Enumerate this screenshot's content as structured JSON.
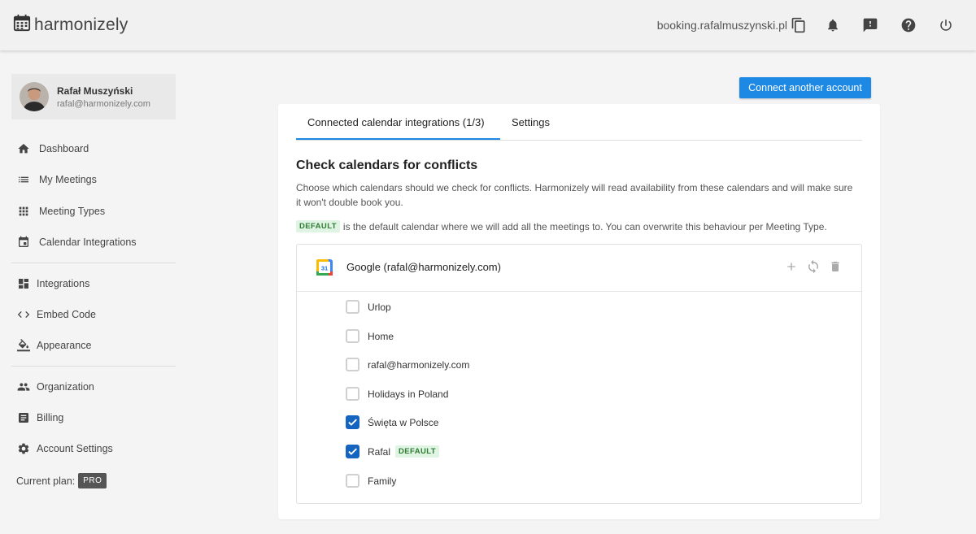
{
  "header": {
    "brand": "harmonizely",
    "booking_url": "booking.rafalmuszynski.pl",
    "icons": [
      "calendar-icon",
      "copy-icon",
      "bell-icon",
      "feedback-icon",
      "help-icon",
      "power-icon"
    ]
  },
  "profile": {
    "name": "Rafał Muszyński",
    "email": "rafal@harmonizely.com"
  },
  "sidebar": {
    "items": [
      {
        "label": "Dashboard",
        "icon": "home-icon"
      },
      {
        "label": "My Meetings",
        "icon": "list-icon"
      },
      {
        "label": "Meeting Types",
        "icon": "grid-icon"
      },
      {
        "label": "Calendar Integrations",
        "icon": "calendar-icon"
      },
      {
        "label": "Integrations",
        "icon": "dashboard-icon"
      },
      {
        "label": "Embed Code",
        "icon": "code-icon"
      },
      {
        "label": "Appearance",
        "icon": "paint-bucket-icon"
      },
      {
        "label": "Organization",
        "icon": "people-icon"
      },
      {
        "label": "Billing",
        "icon": "receipt-icon"
      },
      {
        "label": "Account Settings",
        "icon": "gear-icon"
      }
    ],
    "plan_label": "Current plan:",
    "plan_badge": "PRO"
  },
  "main": {
    "connect_button": "Connect another account",
    "tabs": [
      {
        "label": "Connected calendar integrations (1/3)",
        "active": true
      },
      {
        "label": "Settings",
        "active": false
      }
    ],
    "section_title": "Check calendars for conflicts",
    "description": "Choose which calendars should we check for conflicts. Harmonizely will read availability from these calendars and will make sure it won't double book you.",
    "default_badge": "DEFAULT",
    "default_note": "is the default calendar where we will add all the meetings to. You can overwrite this behaviour per Meeting Type.",
    "account": {
      "name": "Google (rafal@harmonizely.com)",
      "calendar_icon_day": "31",
      "actions": [
        "add-icon",
        "sync-icon",
        "delete-icon"
      ],
      "calendars": [
        {
          "label": "Urlop",
          "checked": false
        },
        {
          "label": "Home",
          "checked": false
        },
        {
          "label": "rafal@harmonizely.com",
          "checked": false
        },
        {
          "label": "Holidays in Poland",
          "checked": false
        },
        {
          "label": "Święta w Polsce",
          "checked": true
        },
        {
          "label": "Rafal",
          "checked": true,
          "badge": "DEFAULT"
        },
        {
          "label": "Family",
          "checked": false
        }
      ]
    }
  },
  "colors": {
    "accent": "#1e88e5",
    "checkbox_checked": "#1565c0",
    "default_badge_bg": "#e0f4e4",
    "default_badge_text": "#2e7d32"
  }
}
